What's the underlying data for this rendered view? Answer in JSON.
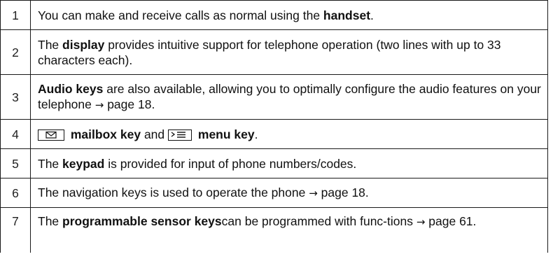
{
  "rows": [
    {
      "num": "1",
      "pre": "You can make and receive calls as normal using the ",
      "bold": "handset",
      "post": "."
    },
    {
      "num": "2",
      "pre": "The ",
      "bold": "display",
      "post": " provides intuitive support for telephone operation (two lines with up to 33 characters each)."
    },
    {
      "num": "3",
      "bold": "Audio keys",
      "post": " are also available, allowing you to optimally configure the audio features on your telephone ",
      "arrow": "→",
      "page": " page 18."
    },
    {
      "num": "4",
      "mailbox_label": "mailbox key",
      "and": " and ",
      "menu_label": "menu key",
      "post": ".",
      "mail_icon": "mailbox-envelope-icon",
      "menu_icon": "menu-list-icon"
    },
    {
      "num": "5",
      "pre": "The ",
      "bold": "keypad",
      "post": " is provided for input of phone numbers/codes."
    },
    {
      "num": "6",
      "pre": "The navigation keys is used to operate the phone ",
      "arrow": "→",
      "page": " page 18."
    },
    {
      "num": "7",
      "pre": "The ",
      "bold": "programmable sensor keys",
      "post": "can be programmed with func-tions ",
      "arrow": "→",
      "page": " page 61."
    }
  ]
}
